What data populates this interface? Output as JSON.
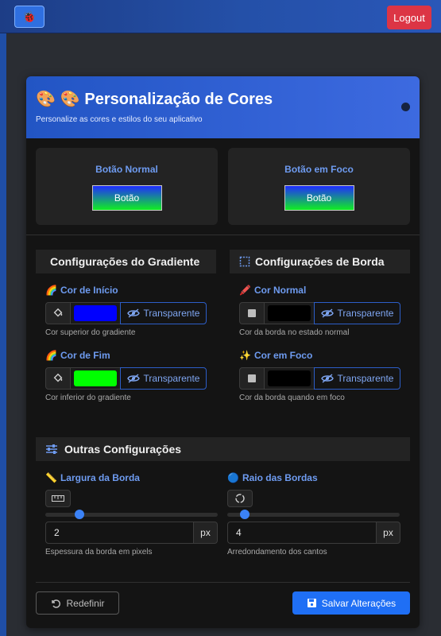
{
  "topbar": {
    "logo_glyph": "🐞",
    "logout_label": "Logout"
  },
  "colors": {
    "header_gradient_start": "#2255c4",
    "accent": "#6e9bf0",
    "logout": "#dc3545",
    "save": "#1f6ff5",
    "gradient_start_color": "#0000ff",
    "gradient_end_color": "#00ff00",
    "border_normal_color": "#000000",
    "border_focus_color": "#000000"
  },
  "header": {
    "icon": "🎨",
    "title": "🎨 Personalização de Cores",
    "subtitle": "Personalize as cores e estilos do seu aplicativo"
  },
  "preview": {
    "normal": {
      "label": "Botão Normal",
      "button_label": "Botão"
    },
    "focus": {
      "label": "Botão em Foco",
      "button_label": "Botão"
    }
  },
  "gradient_section": {
    "title": "Configurações do Gradiente",
    "start": {
      "icon": "🌈",
      "label": "Cor de Início",
      "transparent_label": "Transparente",
      "help": "Cor superior do gradiente"
    },
    "end": {
      "icon": "🌈",
      "label": "Cor de Fim",
      "transparent_label": "Transparente",
      "help": "Cor inferior do gradiente"
    }
  },
  "border_section": {
    "title": "Configurações de Borda",
    "normal": {
      "icon": "🖍️",
      "label": "Cor Normal",
      "transparent_label": "Transparente",
      "help": "Cor da borda no estado normal"
    },
    "focus": {
      "icon": "✨",
      "label": "Cor em Foco",
      "transparent_label": "Transparente",
      "help": "Cor da borda quando em foco"
    }
  },
  "other_section": {
    "title": "Outras Configurações",
    "border_width": {
      "icon": "📏",
      "label": "Largura da Borda",
      "value": "2",
      "unit": "px",
      "slider_fraction": 0.2,
      "help": "Espessura da borda em pixels"
    },
    "border_radius": {
      "icon": "🔵",
      "label": "Raio das Bordas",
      "value": "4",
      "unit": "px",
      "slider_fraction": 0.1,
      "help": "Arredondamento dos cantos"
    }
  },
  "footer": {
    "reset_label": "Redefinir",
    "save_label": "Salvar Alterações"
  }
}
